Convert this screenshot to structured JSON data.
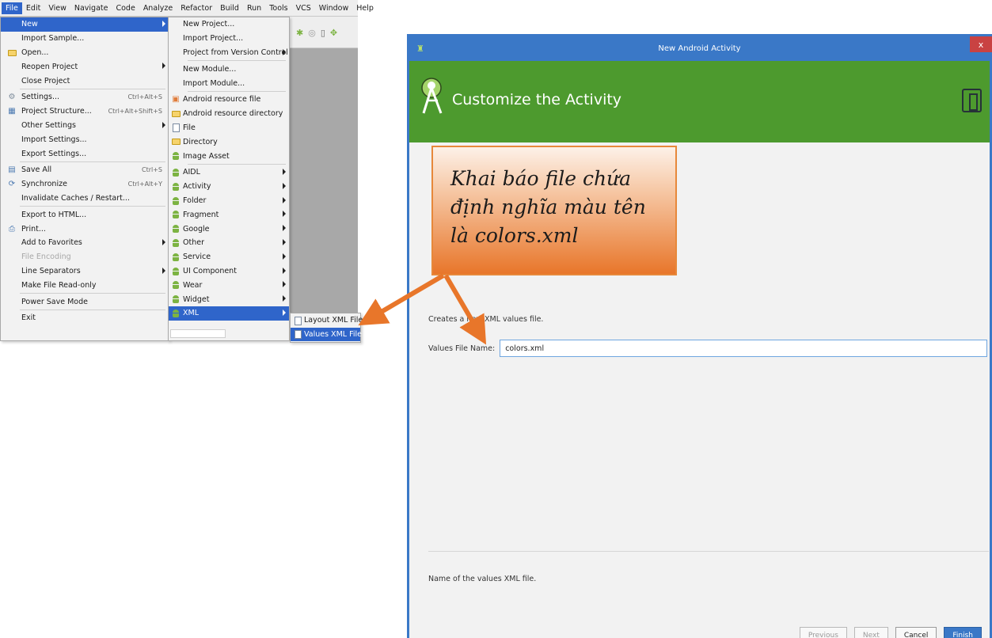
{
  "menubar": {
    "items": [
      "File",
      "Edit",
      "View",
      "Navigate",
      "Code",
      "Analyze",
      "Refactor",
      "Build",
      "Run",
      "Tools",
      "VCS",
      "Window",
      "Help"
    ]
  },
  "file_menu": {
    "new": "New",
    "import_sample": "Import Sample...",
    "open": "Open...",
    "reopen_project": "Reopen Project",
    "close_project": "Close Project",
    "settings": "Settings...",
    "settings_shortcut": "Ctrl+Alt+S",
    "project_structure": "Project Structure...",
    "project_structure_shortcut": "Ctrl+Alt+Shift+S",
    "other_settings": "Other Settings",
    "import_settings": "Import Settings...",
    "export_settings": "Export Settings...",
    "save_all": "Save All",
    "save_all_shortcut": "Ctrl+S",
    "synchronize": "Synchronize",
    "synchronize_shortcut": "Ctrl+Alt+Y",
    "invalidate_caches": "Invalidate Caches / Restart...",
    "export_html": "Export to HTML...",
    "print": "Print...",
    "add_to_favorites": "Add to Favorites",
    "file_encoding": "File Encoding",
    "line_separators": "Line Separators",
    "make_read_only": "Make File Read-only",
    "power_save_mode": "Power Save Mode",
    "exit": "Exit"
  },
  "new_menu": {
    "new_project": "New Project...",
    "import_project": "Import Project...",
    "project_from_vcs": "Project from Version Control",
    "new_module": "New Module...",
    "import_module": "Import Module...",
    "android_resource_file": "Android resource file",
    "android_resource_directory": "Android resource directory",
    "file": "File",
    "directory": "Directory",
    "image_asset": "Image Asset",
    "aidl": "AIDL",
    "activity": "Activity",
    "folder": "Folder",
    "fragment": "Fragment",
    "google": "Google",
    "other": "Other",
    "service": "Service",
    "ui_component": "UI Component",
    "wear": "Wear",
    "widget": "Widget",
    "xml": "XML"
  },
  "xml_menu": {
    "layout_xml_file": "Layout XML File",
    "values_xml_file": "Values XML File"
  },
  "dialog": {
    "window_title": "New Android Activity",
    "close_glyph": "x",
    "banner_title": "Customize the Activity",
    "description": "Creates a new XML values file.",
    "field_label": "Values File Name:",
    "field_value": "colors.xml",
    "hint": "Name of the values XML file.",
    "buttons": {
      "previous": "Previous",
      "next": "Next",
      "cancel": "Cancel",
      "finish": "Finish"
    }
  },
  "callout": {
    "line1": "Khai báo file chứa",
    "line2": "định nghĩa màu tên",
    "line3": "là colors.xml"
  },
  "colors": {
    "menu_highlight": "#2f65ca",
    "dialog_title": "#3a78c7",
    "banner_green": "#4d9a2e",
    "callout_orange": "#e8762a",
    "arrow_orange": "#e8762a"
  },
  "icons": [
    "android-icon",
    "folder-icon",
    "gear-icon",
    "project-structure-icon",
    "save-icon",
    "sync-icon",
    "print-icon",
    "file-icon",
    "resource-file-icon",
    "android-studio-logo-icon",
    "device-icon",
    "close-icon",
    "submenu-arrow-icon"
  ]
}
